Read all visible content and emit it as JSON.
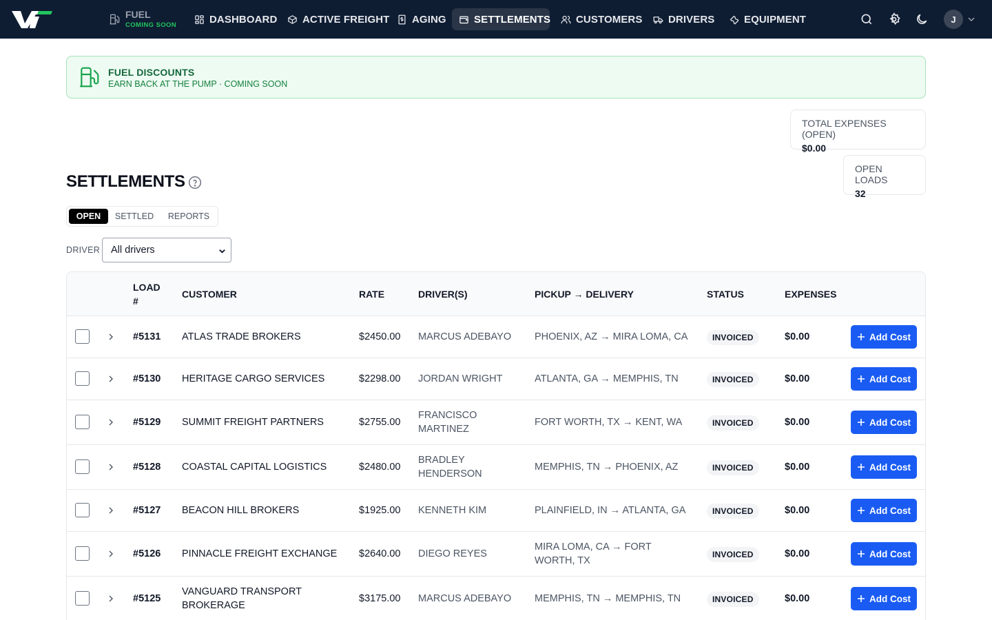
{
  "nav": {
    "fuel_label": "FUEL",
    "fuel_badge": "COMING SOON",
    "items": [
      {
        "label": "DASHBOARD",
        "icon": "dashboard-icon"
      },
      {
        "label": "ACTIVE FREIGHT",
        "icon": "package-icon"
      },
      {
        "label": "AGING",
        "icon": "invoice-icon"
      },
      {
        "label": "SETTLEMENTS",
        "icon": "wallet-icon",
        "active": true
      },
      {
        "label": "CUSTOMERS",
        "icon": "users-icon"
      },
      {
        "label": "DRIVERS",
        "icon": "truck-icon"
      },
      {
        "label": "EQUIPMENT",
        "icon": "wrench-icon"
      }
    ],
    "avatar_initial": "J"
  },
  "banner": {
    "title": "FUEL DISCOUNTS",
    "subtitle": "EARN BACK AT THE PUMP · COMING SOON"
  },
  "stats": {
    "total_expenses_label": "TOTAL EXPENSES (OPEN)",
    "total_expenses_value": "$0.00",
    "open_loads_label": "OPEN LOADS",
    "open_loads_value": "32"
  },
  "page": {
    "title": "SETTLEMENTS",
    "tabs": [
      "OPEN",
      "SETTLED",
      "REPORTS"
    ],
    "active_tab": "OPEN"
  },
  "filter": {
    "label": "DRIVER",
    "selected": "All drivers"
  },
  "table": {
    "headers": {
      "load": "LOAD #",
      "customer": "CUSTOMER",
      "rate": "RATE",
      "drivers": "DRIVER(S)",
      "route": "PICKUP → DELIVERY",
      "status": "STATUS",
      "expenses": "EXPENSES"
    },
    "add_label": "Add Cost",
    "rows": [
      {
        "load": "#5131",
        "customer": "ATLAS TRADE BROKERS",
        "rate": "$2450.00",
        "driver": "MARCUS ADEBAYO",
        "route": "PHOENIX, AZ → MIRA LOMA, CA",
        "status": "INVOICED",
        "expenses": "$0.00"
      },
      {
        "load": "#5130",
        "customer": "HERITAGE CARGO SERVICES",
        "rate": "$2298.00",
        "driver": "JORDAN WRIGHT",
        "route": "ATLANTA, GA → MEMPHIS, TN",
        "status": "INVOICED",
        "expenses": "$0.00"
      },
      {
        "load": "#5129",
        "customer": "SUMMIT FREIGHT PARTNERS",
        "rate": "$2755.00",
        "driver": "FRANCISCO MARTINEZ",
        "route": "FORT WORTH, TX → KENT, WA",
        "status": "INVOICED",
        "expenses": "$0.00"
      },
      {
        "load": "#5128",
        "customer": "COASTAL CAPITAL LOGISTICS",
        "rate": "$2480.00",
        "driver": "BRADLEY HENDERSON",
        "route": "MEMPHIS, TN → PHOENIX, AZ",
        "status": "INVOICED",
        "expenses": "$0.00"
      },
      {
        "load": "#5127",
        "customer": "BEACON HILL BROKERS",
        "rate": "$1925.00",
        "driver": "KENNETH KIM",
        "route": "PLAINFIELD, IN → ATLANTA, GA",
        "status": "INVOICED",
        "expenses": "$0.00"
      },
      {
        "load": "#5126",
        "customer": "PINNACLE FREIGHT EXCHANGE",
        "rate": "$2640.00",
        "driver": "DIEGO REYES",
        "route": "MIRA LOMA, CA → FORT WORTH, TX",
        "status": "INVOICED",
        "expenses": "$0.00"
      },
      {
        "load": "#5125",
        "customer": "VANGUARD TRANSPORT BROKERAGE",
        "rate": "$3175.00",
        "driver": "MARCUS ADEBAYO",
        "route": "MEMPHIS, TN → MEMPHIS, TN",
        "status": "INVOICED",
        "expenses": "$0.00"
      }
    ]
  },
  "colors": {
    "nav_bg": "#0f1d33",
    "accent_green": "#22c55e",
    "primary_button": "#1a5cf3"
  }
}
